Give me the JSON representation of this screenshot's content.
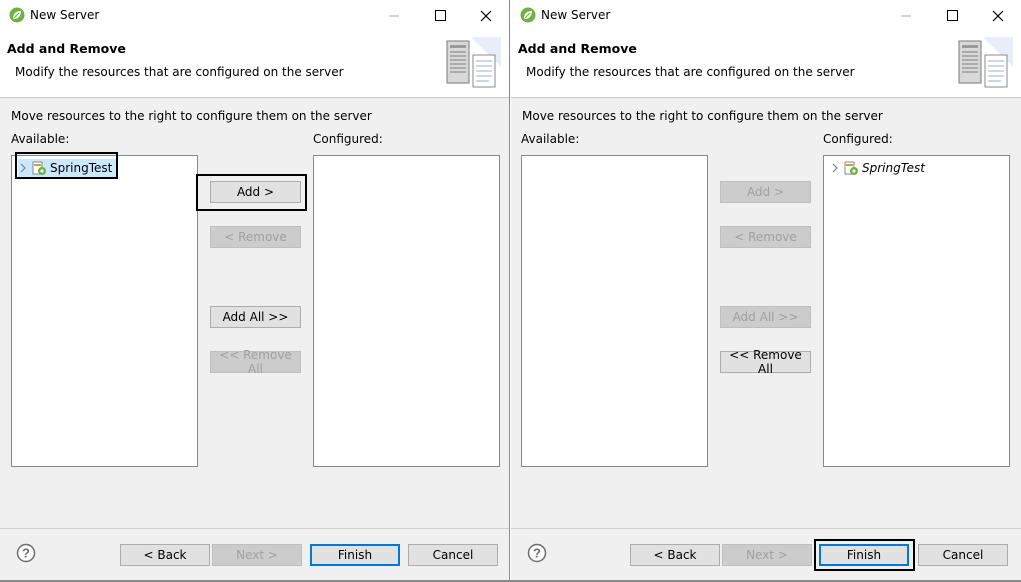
{
  "dialogs": [
    {
      "window_title": "New Server",
      "header_title": "Add and Remove",
      "header_desc": "Modify the resources that are configured on the server",
      "instruction": "Move resources to the right to configure them on the server",
      "available_label": "Available:",
      "configured_label": "Configured:",
      "available_items": [
        "SpringTest"
      ],
      "configured_items": [],
      "buttons": {
        "add": "Add >",
        "remove": "< Remove",
        "add_all": "Add All >>",
        "remove_all": "<< Remove All"
      },
      "footer": {
        "back": "< Back",
        "next": "Next >",
        "finish": "Finish",
        "cancel": "Cancel"
      }
    },
    {
      "window_title": "New Server",
      "header_title": "Add and Remove",
      "header_desc": "Modify the resources that are configured on the server",
      "instruction": "Move resources to the right to configure them on the server",
      "available_label": "Available:",
      "configured_label": "Configured:",
      "available_items": [],
      "configured_items": [
        "SpringTest"
      ],
      "buttons": {
        "add": "Add >",
        "remove": "< Remove",
        "add_all": "Add All >>",
        "remove_all": "<< Remove All"
      },
      "footer": {
        "back": "< Back",
        "next": "Next >",
        "finish": "Finish",
        "cancel": "Cancel"
      }
    }
  ],
  "icons": {
    "app": "spring-leaf-icon",
    "header": "server-icon",
    "project": "project-icon",
    "expand": "chevron-right-icon",
    "help": "help-icon"
  },
  "colors": {
    "selection": "#cce8ff",
    "default_button_border": "#0078d7",
    "spring_green": "#6db33f"
  }
}
